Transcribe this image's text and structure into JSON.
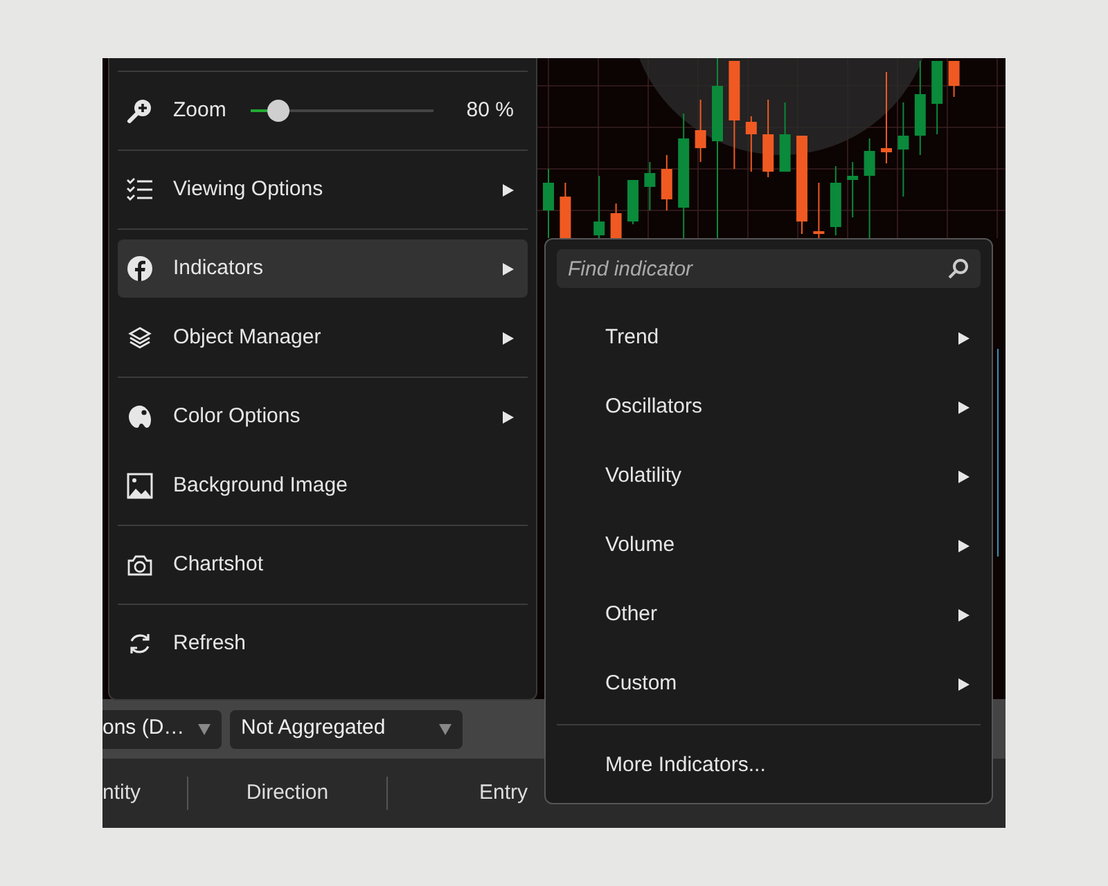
{
  "main_menu": {
    "groups": [
      [
        {
          "kind": "slider",
          "label": "Zoom",
          "level": 0.15,
          "reading": "80 %"
        }
      ],
      [
        {
          "kind": "submenu",
          "label": "Viewing Options",
          "selected": false
        }
      ],
      [
        {
          "kind": "submenu",
          "label": "Indicators",
          "selected": true
        },
        {
          "kind": "submenu",
          "label": "Object Manager",
          "selected": false
        }
      ],
      [
        {
          "kind": "submenu",
          "label": "Color Options",
          "selected": false
        },
        {
          "kind": "action",
          "label": "Background Image",
          "selected": false
        }
      ],
      [
        {
          "kind": "action",
          "label": "Chartshot",
          "selected": false
        }
      ],
      [
        {
          "kind": "action",
          "label": "Refresh",
          "selected": false
        }
      ]
    ]
  },
  "indicator_menu": {
    "search": {
      "placeholder": "Find indicator"
    },
    "groups": [
      [
        {
          "kind": "submenu",
          "label": "Trend"
        },
        {
          "kind": "submenu",
          "label": "Oscillators"
        },
        {
          "kind": "submenu",
          "label": "Volatility"
        },
        {
          "kind": "submenu",
          "label": "Volume"
        },
        {
          "kind": "submenu",
          "label": "Other"
        },
        {
          "kind": "submenu",
          "label": "Custom"
        }
      ],
      [
        {
          "kind": "action",
          "label": "More Indicators..."
        }
      ]
    ]
  },
  "toolbar": {
    "dropdowns": [
      "ons (D…",
      "Not Aggregated"
    ]
  },
  "table": {
    "columns": [
      "ntity",
      "Direction",
      "Entry"
    ]
  }
}
